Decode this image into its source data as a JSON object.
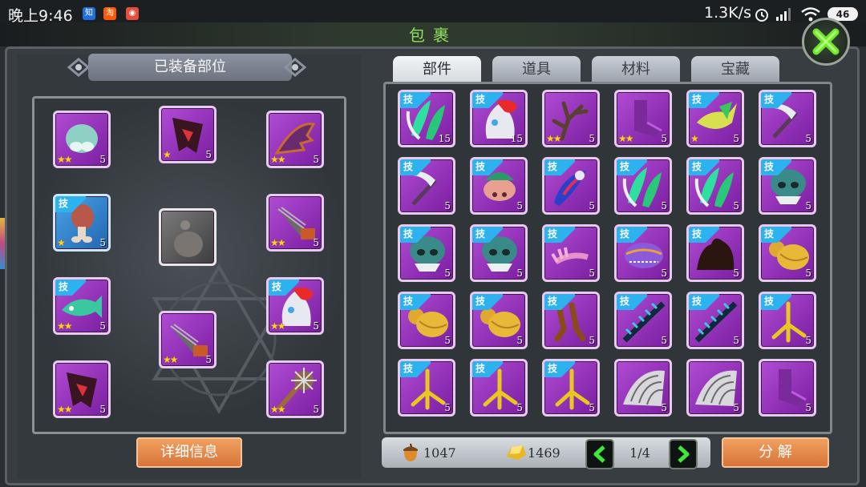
{
  "status_bar": {
    "time": "晚上9:46",
    "apps": [
      {
        "icon": "zhihu-app-icon",
        "glyph": "知",
        "color": "#1f6fe0"
      },
      {
        "icon": "taobao-app-icon",
        "glyph": "淘",
        "color": "#ff5a00"
      },
      {
        "icon": "weibo-app-icon",
        "glyph": "◉",
        "color": "#e84c3d"
      }
    ],
    "speed": "1.3K/s",
    "battery": "46"
  },
  "window": {
    "title": "包裹"
  },
  "equipped": {
    "header": "已装备部位",
    "detail_button": "详细信息",
    "slots": [
      {
        "name": "equipped-slot-1",
        "art": "skull-blob",
        "color": "purple",
        "skill": false,
        "stars": "★★",
        "count": "5"
      },
      {
        "name": "equipped-slot-2",
        "art": "dark-wing",
        "color": "purple",
        "skill": false,
        "stars": "★",
        "count": "5"
      },
      {
        "name": "equipped-slot-3",
        "art": "bat-wing",
        "color": "purple",
        "skill": false,
        "stars": "★★",
        "count": "5"
      },
      {
        "name": "equipped-slot-4",
        "art": "leg",
        "color": "blue",
        "skill": true,
        "stars": "★",
        "count": "5"
      },
      {
        "name": "equipped-slot-5",
        "art": "gourd-gray",
        "color": "gray",
        "skill": false,
        "stars": "",
        "count": ""
      },
      {
        "name": "equipped-slot-6",
        "art": "drill",
        "color": "purple",
        "skill": false,
        "stars": "★★",
        "count": "5"
      },
      {
        "name": "equipped-slot-7",
        "art": "fish",
        "color": "purple",
        "skill": true,
        "stars": "★★",
        "count": "5"
      },
      {
        "name": "equipped-slot-8",
        "art": "flame-mask",
        "color": "purple",
        "skill": true,
        "stars": "★★",
        "count": "5"
      },
      {
        "name": "equipped-slot-9",
        "art": "drill",
        "color": "purple",
        "skill": false,
        "stars": "★★",
        "count": "5"
      },
      {
        "name": "equipped-slot-10",
        "art": "dark-wing",
        "color": "purple",
        "skill": false,
        "stars": "★★",
        "count": "5"
      },
      {
        "name": "equipped-slot-11",
        "art": "spiked-mace",
        "color": "purple",
        "skill": false,
        "stars": "★★",
        "count": "5"
      }
    ]
  },
  "tabs": [
    {
      "label": "部件",
      "active": true
    },
    {
      "label": "道具",
      "active": false
    },
    {
      "label": "材料",
      "active": false
    },
    {
      "label": "宝藏",
      "active": false
    }
  ],
  "inventory": [
    {
      "art": "green-feather",
      "skill": true,
      "stars": "",
      "count": "15"
    },
    {
      "art": "flame-mask",
      "skill": true,
      "stars": "",
      "count": "15"
    },
    {
      "art": "antler",
      "skill": false,
      "stars": "★★",
      "count": "5"
    },
    {
      "art": "boot",
      "skill": false,
      "stars": "★★",
      "count": "5"
    },
    {
      "art": "yellow-fish",
      "skill": true,
      "stars": "★",
      "count": "5"
    },
    {
      "art": "scythe",
      "skill": true,
      "stars": "",
      "count": "5"
    },
    {
      "art": "scythe",
      "skill": true,
      "stars": "",
      "count": "5"
    },
    {
      "art": "pig-head",
      "skill": true,
      "stars": "",
      "count": "5"
    },
    {
      "art": "feather-blue",
      "skill": true,
      "stars": "",
      "count": "5"
    },
    {
      "art": "green-feather",
      "skill": true,
      "stars": "",
      "count": "5"
    },
    {
      "art": "green-feather",
      "skill": true,
      "stars": "",
      "count": "5"
    },
    {
      "art": "teal-skull",
      "skill": true,
      "stars": "",
      "count": "5"
    },
    {
      "art": "teal-skull",
      "skill": true,
      "stars": "",
      "count": "5"
    },
    {
      "art": "teal-skull",
      "skill": true,
      "stars": "",
      "count": "5"
    },
    {
      "art": "claw-pink",
      "skill": true,
      "stars": "",
      "count": "5"
    },
    {
      "art": "purple-beast",
      "skill": true,
      "stars": "",
      "count": "5"
    },
    {
      "art": "dark-blob",
      "skill": true,
      "stars": "",
      "count": "5"
    },
    {
      "art": "gourd",
      "skill": true,
      "stars": "",
      "count": "5"
    },
    {
      "art": "gourd",
      "skill": true,
      "stars": "",
      "count": "5"
    },
    {
      "art": "gourd",
      "skill": true,
      "stars": "",
      "count": "5"
    },
    {
      "art": "brown-legs",
      "skill": true,
      "stars": "",
      "count": "5"
    },
    {
      "art": "spiked-tail",
      "skill": true,
      "stars": "",
      "count": "5"
    },
    {
      "art": "spiked-tail",
      "skill": true,
      "stars": "",
      "count": "5"
    },
    {
      "art": "yellow-claw",
      "skill": true,
      "stars": "",
      "count": "5"
    },
    {
      "art": "yellow-claw",
      "skill": true,
      "stars": "",
      "count": "5"
    },
    {
      "art": "yellow-claw",
      "skill": true,
      "stars": "",
      "count": "5"
    },
    {
      "art": "yellow-claw",
      "skill": true,
      "stars": "",
      "count": "5"
    },
    {
      "art": "silver-wing",
      "skill": false,
      "stars": "",
      "count": "5"
    },
    {
      "art": "silver-wing",
      "skill": false,
      "stars": "",
      "count": "5"
    },
    {
      "art": "boot",
      "skill": false,
      "stars": "",
      "count": "5"
    }
  ],
  "skill_badge": "技",
  "currency": {
    "acorns": "1047",
    "gold": "1469"
  },
  "pagination": {
    "label": "1/4"
  },
  "decompose_button": "分 解"
}
